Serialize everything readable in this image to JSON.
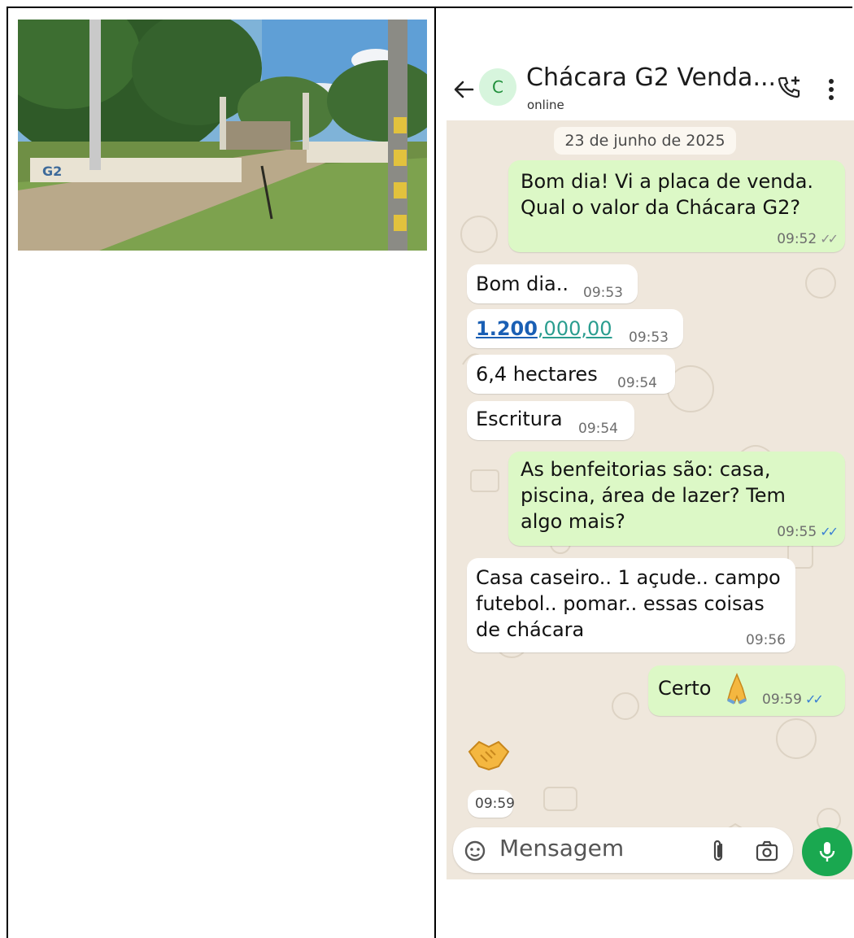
{
  "chat": {
    "contact_name": "Chácara G2 Venda...",
    "avatar_letter": "C",
    "status": "online",
    "date_chip": "23 de junho de 2025",
    "messages": [
      {
        "direction": "outgoing",
        "lines": [
          "Bom dia! Vi a placa de venda.",
          "Qual o valor da Chácara G2?"
        ],
        "time": "09:52",
        "ticks": "read-gray"
      },
      {
        "direction": "incoming",
        "text": "Bom dia..",
        "time": "09:53"
      },
      {
        "direction": "incoming",
        "price_part1": "1.200",
        "price_part2": ",000,00",
        "time": "09:53"
      },
      {
        "direction": "incoming",
        "text": "6,4 hectares",
        "time": "09:54"
      },
      {
        "direction": "incoming",
        "text": "Escritura",
        "time": "09:54"
      },
      {
        "direction": "outgoing",
        "lines": [
          "As benfeitorias são: casa,",
          "piscina, área de lazer? Tem",
          "algo mais?"
        ],
        "time": "09:55",
        "ticks": "read-blue"
      },
      {
        "direction": "incoming",
        "lines": [
          "Casa caseiro.. 1 açude.. campo",
          "futebol.. pomar.. essas coisas",
          "de chácara"
        ],
        "time": "09:56"
      },
      {
        "direction": "outgoing",
        "text": "Certo",
        "emoji": "folded-hands",
        "time": "09:59",
        "ticks": "read-blue"
      },
      {
        "direction": "incoming",
        "emoji": "handshake",
        "time": "09:59"
      }
    ]
  },
  "composer": {
    "placeholder": "Mensagem"
  },
  "icons": {
    "back": "arrow-left-icon",
    "call": "add-call-icon",
    "more": "more-vert-icon",
    "sticker": "sticker-icon",
    "attach": "paperclip-icon",
    "camera": "camera-icon",
    "mic": "microphone-icon"
  },
  "colors": {
    "outgoing_bubble": "#dcf8c6",
    "incoming_bubble": "#ffffff",
    "mic_button": "#1aa850",
    "read_tick": "#3a7fd3"
  }
}
